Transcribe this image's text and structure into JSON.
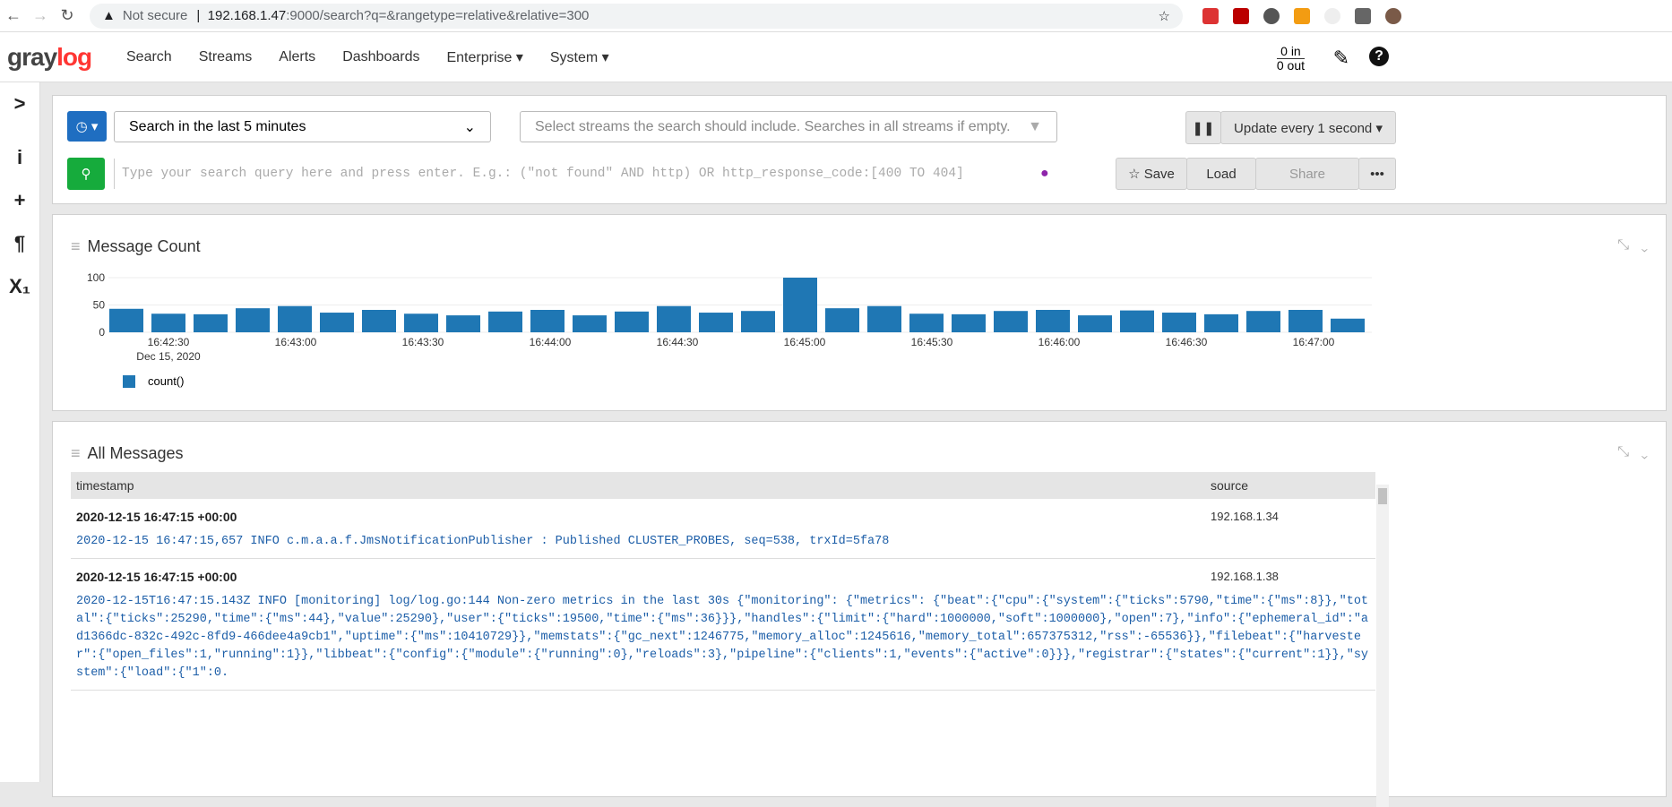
{
  "browser": {
    "security": "Not secure",
    "url_host": "192.168.1.47",
    "url_rest": ":9000/search?q=&rangetype=relative&relative=300"
  },
  "nav": {
    "logo_a": "gray",
    "logo_b": "log",
    "items": [
      "Search",
      "Streams",
      "Alerts",
      "Dashboards",
      "Enterprise ▾",
      "System ▾"
    ],
    "throughput_in": "0 in",
    "throughput_out": "0 out"
  },
  "search": {
    "range": "Search in the last 5 minutes",
    "streams_placeholder": "Select streams the search should include. Searches in all streams if empty.",
    "query_placeholder": "Type your search query here and press enter. E.g.: (\"not found\" AND http) OR http_response_code:[400 TO 404]",
    "update": "Update every 1 second ▾",
    "save": "☆ Save",
    "load": "Load",
    "share": "Share",
    "more": "•••"
  },
  "chart_panel": {
    "title": "Message Count"
  },
  "chart_data": {
    "type": "bar",
    "title": "Message Count",
    "ylim": [
      0,
      110
    ],
    "yticks": [
      "0",
      "50",
      "100"
    ],
    "xticks": [
      "16:42:30",
      "16:43:00",
      "16:43:30",
      "16:44:00",
      "16:44:30",
      "16:45:00",
      "16:45:30",
      "16:46:00",
      "16:46:30",
      "16:47:00"
    ],
    "xsub": "Dec 15, 2020",
    "legend": "count()",
    "color": "#1f77b4",
    "values": [
      43,
      34,
      33,
      44,
      48,
      36,
      41,
      34,
      31,
      38,
      41,
      31,
      38,
      48,
      36,
      39,
      100,
      44,
      48,
      34,
      33,
      39,
      41,
      31,
      40,
      36,
      33,
      39,
      41,
      25
    ]
  },
  "messages": {
    "title": "All Messages",
    "columns": [
      "timestamp",
      "source"
    ],
    "rows": [
      {
        "timestamp": "2020-12-15 16:47:15 +00:00",
        "source": "192.168.1.34",
        "message": "2020-12-15 16:47:15,657 INFO c.m.a.a.f.JmsNotificationPublisher : Published CLUSTER_PROBES, seq=538, trxId=5fa78"
      },
      {
        "timestamp": "2020-12-15 16:47:15 +00:00",
        "source": "192.168.1.38",
        "message": "2020-12-15T16:47:15.143Z INFO [monitoring] log/log.go:144 Non-zero metrics in the last 30s {\"monitoring\": {\"metrics\": {\"beat\":{\"cpu\":{\"system\":{\"ticks\":5790,\"time\":{\"ms\":8}},\"total\":{\"ticks\":25290,\"time\":{\"ms\":44},\"value\":25290},\"user\":{\"ticks\":19500,\"time\":{\"ms\":36}}},\"handles\":{\"limit\":{\"hard\":1000000,\"soft\":1000000},\"open\":7},\"info\":{\"ephemeral_id\":\"ad1366dc-832c-492c-8fd9-466dee4a9cb1\",\"uptime\":{\"ms\":10410729}},\"memstats\":{\"gc_next\":1246775,\"memory_alloc\":1245616,\"memory_total\":657375312,\"rss\":-65536}},\"filebeat\":{\"harvester\":{\"open_files\":1,\"running\":1}},\"libbeat\":{\"config\":{\"module\":{\"running\":0},\"reloads\":3},\"pipeline\":{\"clients\":1,\"events\":{\"active\":0}}},\"registrar\":{\"states\":{\"current\":1}},\"system\":{\"load\":{\"1\":0."
      }
    ]
  }
}
